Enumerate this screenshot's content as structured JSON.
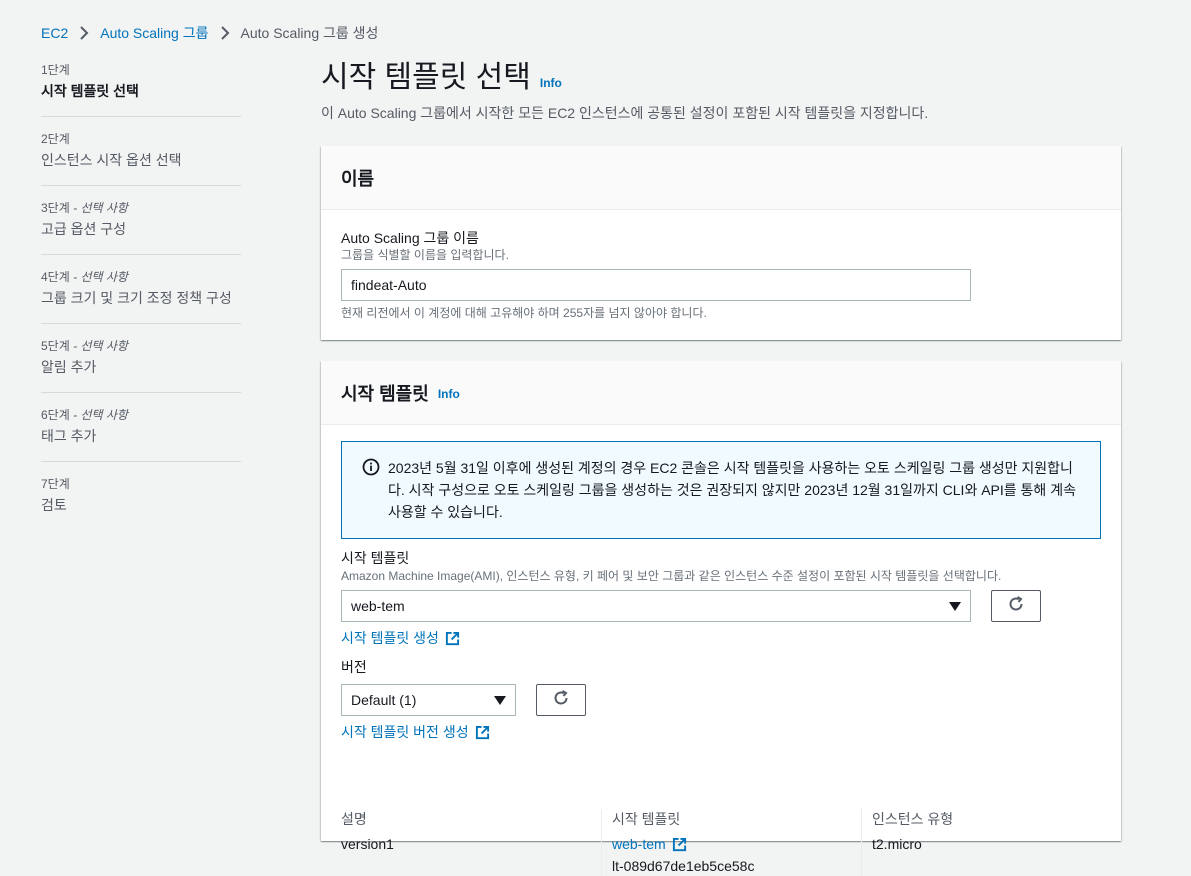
{
  "breadcrumb": {
    "items": [
      "EC2",
      "Auto Scaling 그룹",
      "Auto Scaling 그룹 생성"
    ]
  },
  "steps": [
    {
      "num": "1단계",
      "optional": "",
      "title": "시작 템플릿 선택"
    },
    {
      "num": "2단계",
      "optional": "",
      "title": "인스턴스 시작 옵션 선택"
    },
    {
      "num": "3단계",
      "optional": "- 선택 사항",
      "title": "고급 옵션 구성"
    },
    {
      "num": "4단계",
      "optional": "- 선택 사항",
      "title": "그룹 크기 및 크기 조정 정책 구성"
    },
    {
      "num": "5단계",
      "optional": "- 선택 사항",
      "title": "알림 추가"
    },
    {
      "num": "6단계",
      "optional": "- 선택 사항",
      "title": "태그 추가"
    },
    {
      "num": "7단계",
      "optional": "",
      "title": "검토"
    }
  ],
  "page": {
    "title": "시작 템플릿 선택",
    "info": "Info",
    "description": "이 Auto Scaling 그룹에서 시작한 모든 EC2 인스턴스에 공통된 설정이 포함된 시작 템플릿을 지정합니다."
  },
  "name_panel": {
    "header": "이름",
    "label": "Auto Scaling 그룹 이름",
    "description": "그룹을 식별할 이름을 입력합니다.",
    "value": "findeat-Auto",
    "constraint": "현재 리전에서 이 계정에 대해 고유해야 하며 255자를 넘지 않아야 합니다."
  },
  "template_panel": {
    "header": "시작 템플릿",
    "info": "Info",
    "alert_text": "2023년 5월 31일 이후에 생성된 계정의 경우 EC2 콘솔은 시작 템플릿을 사용하는 오토 스케일링 그룹 생성만 지원합니다. 시작 구성으로 오토 스케일링 그룹을 생성하는 것은 권장되지 않지만 2023년 12월 31일까지 CLI와 API를 통해 계속 사용할 수 있습니다.",
    "template_label": "시작 템플릿",
    "template_description": "Amazon Machine Image(AMI), 인스턴스 유형, 키 페어 및 보안 그룹과 같은 인스턴스 수준 설정이 포함된 시작 템플릿을 선택합니다.",
    "template_selected": "web-tem",
    "create_template_link": "시작 템플릿 생성",
    "version_label": "버전",
    "version_selected": "Default (1)",
    "create_version_link": "시작 템플릿 버전 생성",
    "summary": {
      "description_label": "설명",
      "description_value": "version1",
      "template_label": "시작 템플릿",
      "template_link": "web-tem",
      "template_id": "lt-089d67de1eb5ce58c",
      "instance_type_label": "인스턴스 유형",
      "instance_type_value": "t2.micro"
    }
  },
  "colors": {
    "link": "#0073bb",
    "alert_border": "#0073bb",
    "alert_bg": "#f1faff",
    "page_bg": "#f2f3f3"
  }
}
